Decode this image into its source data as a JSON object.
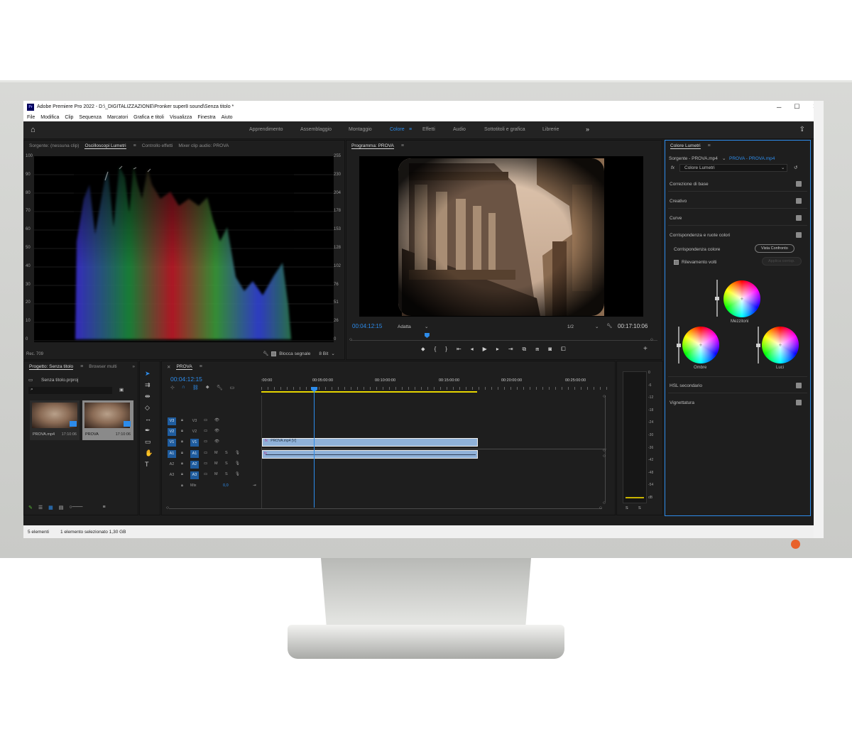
{
  "window": {
    "title": "Adobe Premiere Pro 2022 - D:\\_DIGITALIZZAZIONE\\Pronker super8 sound\\Senza titolo *",
    "minimize": "─",
    "maximize": "☐",
    "close": "✕"
  },
  "menu": [
    "File",
    "Modifica",
    "Clip",
    "Sequenza",
    "Marcatori",
    "Grafica e titoli",
    "Visualizza",
    "Finestra",
    "Aiuto"
  ],
  "workspaces": {
    "items": [
      "Apprendimento",
      "Assemblaggio",
      "Montaggio",
      "Colore",
      "Effetti",
      "Audio",
      "Sottotitoli e grafica",
      "Librerie"
    ],
    "active": "Colore",
    "more": "»"
  },
  "source_panel": {
    "tabs": [
      "Sorgente: (nessuna clip)",
      "Oscilloscopi Lumetri",
      "Controllo effetti",
      "Mixer clip audio: PROVA"
    ],
    "active_tab": "Oscilloscopi Lumetri",
    "scale_left": [
      "100",
      "90",
      "80",
      "70",
      "60",
      "50",
      "40",
      "30",
      "20",
      "10",
      "0"
    ],
    "scale_right": [
      "255",
      "230",
      "204",
      "178",
      "153",
      "128",
      "102",
      "76",
      "51",
      "26",
      "0"
    ],
    "footer_label": "Rec. 709",
    "clamp_label": "Blocca segnale",
    "bit_depth": "8 Bit"
  },
  "program_panel": {
    "title": "Programma: PROVA",
    "timecode": "00:04:12:15",
    "fit": "Adatta",
    "resolution": "1/2",
    "duration": "00:17:10:06",
    "playhead_fraction": 0.245
  },
  "lumetri": {
    "title": "Colore Lumetri",
    "source": "Sorgente - PROVA.mp4",
    "target": "PROVA - PROVA.mp4",
    "effect": "Colore Lumetri",
    "sections": [
      "Correzione di base",
      "Creativo",
      "Curve",
      "Corrispondenza e ruote colori"
    ],
    "match_label": "Corrispondenza colore",
    "compare_button": "Vista Confronto",
    "face_detect": "Rilevamento volti",
    "apply_button": "Applica corrisp.",
    "wheels": {
      "midtones": "Mezzitoni",
      "shadows": "Ombre",
      "highlights": "Luci"
    },
    "bottom_sections": [
      "HSL secondario",
      "Vignettatura"
    ]
  },
  "project_panel": {
    "tabs": [
      "Progetto: Senza titolo",
      "Browser multi"
    ],
    "project_file": "Senza titolo.prproj",
    "items": [
      {
        "name": "PROVA.mp4",
        "duration": "17:10:06"
      },
      {
        "name": "PROVA",
        "duration": "17:10:06"
      }
    ]
  },
  "timeline": {
    "sequence": "PROVA",
    "timecode": "00:04:12:15",
    "ruler": [
      ":00:00",
      "00:05:00:00",
      "00:10:00:00",
      "00:15:00:00",
      "00:20:00:00",
      "00:25:00:00"
    ],
    "video_tracks": [
      "V3",
      "V2",
      "V1"
    ],
    "audio_tracks": [
      "A1",
      "A2",
      "A3"
    ],
    "mix_label": "Mix",
    "mix_value": "0,0",
    "video_clip": "PROVA.mp4 [V]",
    "fx_badge": "fx"
  },
  "audio_meter": {
    "scale": [
      "0",
      "-6",
      "-12",
      "-18",
      "-24",
      "-30",
      "-36",
      "-42",
      "-48",
      "-54",
      "dB"
    ],
    "solo": [
      "S",
      "S"
    ]
  },
  "status": {
    "items": "5 elementi",
    "selection": "1 elemento selezionato 1,30 GB"
  },
  "colors": {
    "accent": "#2d8ceb",
    "panel_bg": "#1e1e1e",
    "clip": "#8fb1d8",
    "led": "#e8622b"
  }
}
